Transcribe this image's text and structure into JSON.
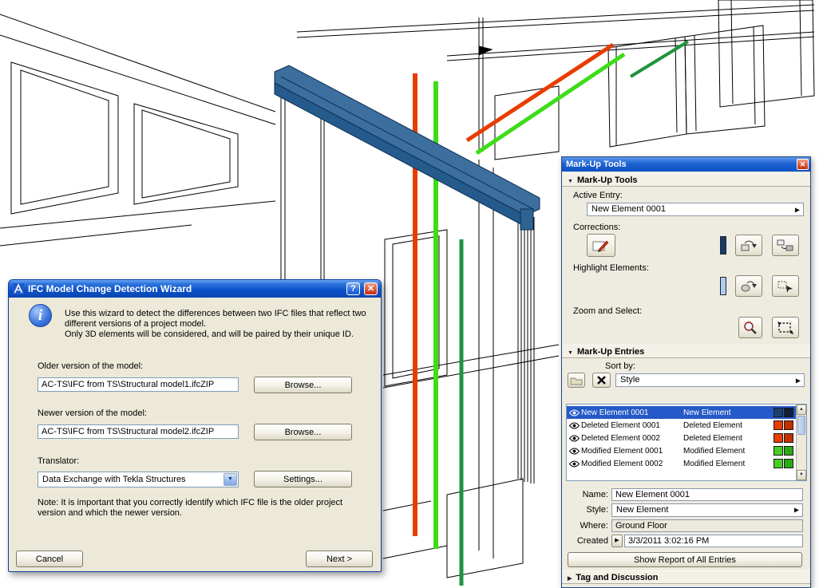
{
  "wizard": {
    "title": "IFC Model Change Detection Wizard",
    "help_label": "?",
    "close_label": "✕",
    "intro1": "Use this wizard to detect the differences between two IFC files that reflect two different versions of a project model.",
    "intro2": "Only 3D elements will be considered, and will be paired by their unique ID.",
    "older_label": "Older version of the model:",
    "older_value": "AC-TS\\IFC from TS\\Structural model1.ifcZIP",
    "newer_label": "Newer version of the model:",
    "newer_value": "AC-TS\\IFC from TS\\Structural model2.ifcZIP",
    "browse_label": "Browse...",
    "translator_label": "Translator:",
    "translator_value": "Data Exchange with Tekla Structures",
    "settings_label": "Settings...",
    "note": "Note: It is important that you correctly identify which IFC file is the older project version and which the newer version.",
    "cancel_label": "Cancel",
    "next_label": "Next >"
  },
  "palette": {
    "title": "Mark-Up Tools",
    "close_label": "✕",
    "section_tools": "Mark-Up Tools",
    "section_entries": "Mark-Up Entries",
    "section_tag": "Tag and Discussion",
    "active_entry_label": "Active Entry:",
    "active_entry_value": "New Element 0001",
    "corrections_label": "Corrections:",
    "highlight_label": "Highlight Elements:",
    "zoom_label": "Zoom and Select:",
    "sort_by_label": "Sort by:",
    "sort_by_value": "Style",
    "entries": [
      {
        "name": "New Element 0001",
        "style": "New Element",
        "swatch1": "#1d4070",
        "swatch2": "#101f3c"
      },
      {
        "name": "Deleted Element 0001",
        "style": "Deleted Element",
        "swatch1": "#e83c00",
        "swatch2": "#c22f00"
      },
      {
        "name": "Deleted Element 0002",
        "style": "Deleted Element",
        "swatch1": "#e83c00",
        "swatch2": "#c22f00"
      },
      {
        "name": "Modified Element 0001",
        "style": "Modified Element",
        "swatch1": "#46d024",
        "swatch2": "#2aa816"
      },
      {
        "name": "Modified Element 0002",
        "style": "Modified Element",
        "swatch1": "#46d024",
        "swatch2": "#2aa816"
      }
    ],
    "detail": {
      "name_label": "Name:",
      "name_value": "New Element 0001",
      "style_label": "Style:",
      "style_value": "New Element",
      "where_label": "Where:",
      "where_value": "Ground Floor",
      "created_label": "Created",
      "created_value": "3/3/2011 3:02:16 PM"
    },
    "report_button": "Show Report of All Entries",
    "markup_colors": {
      "new_element": "#2e6391",
      "deleted_element": "#e83c00",
      "modified_element": "#3ddd17"
    }
  }
}
